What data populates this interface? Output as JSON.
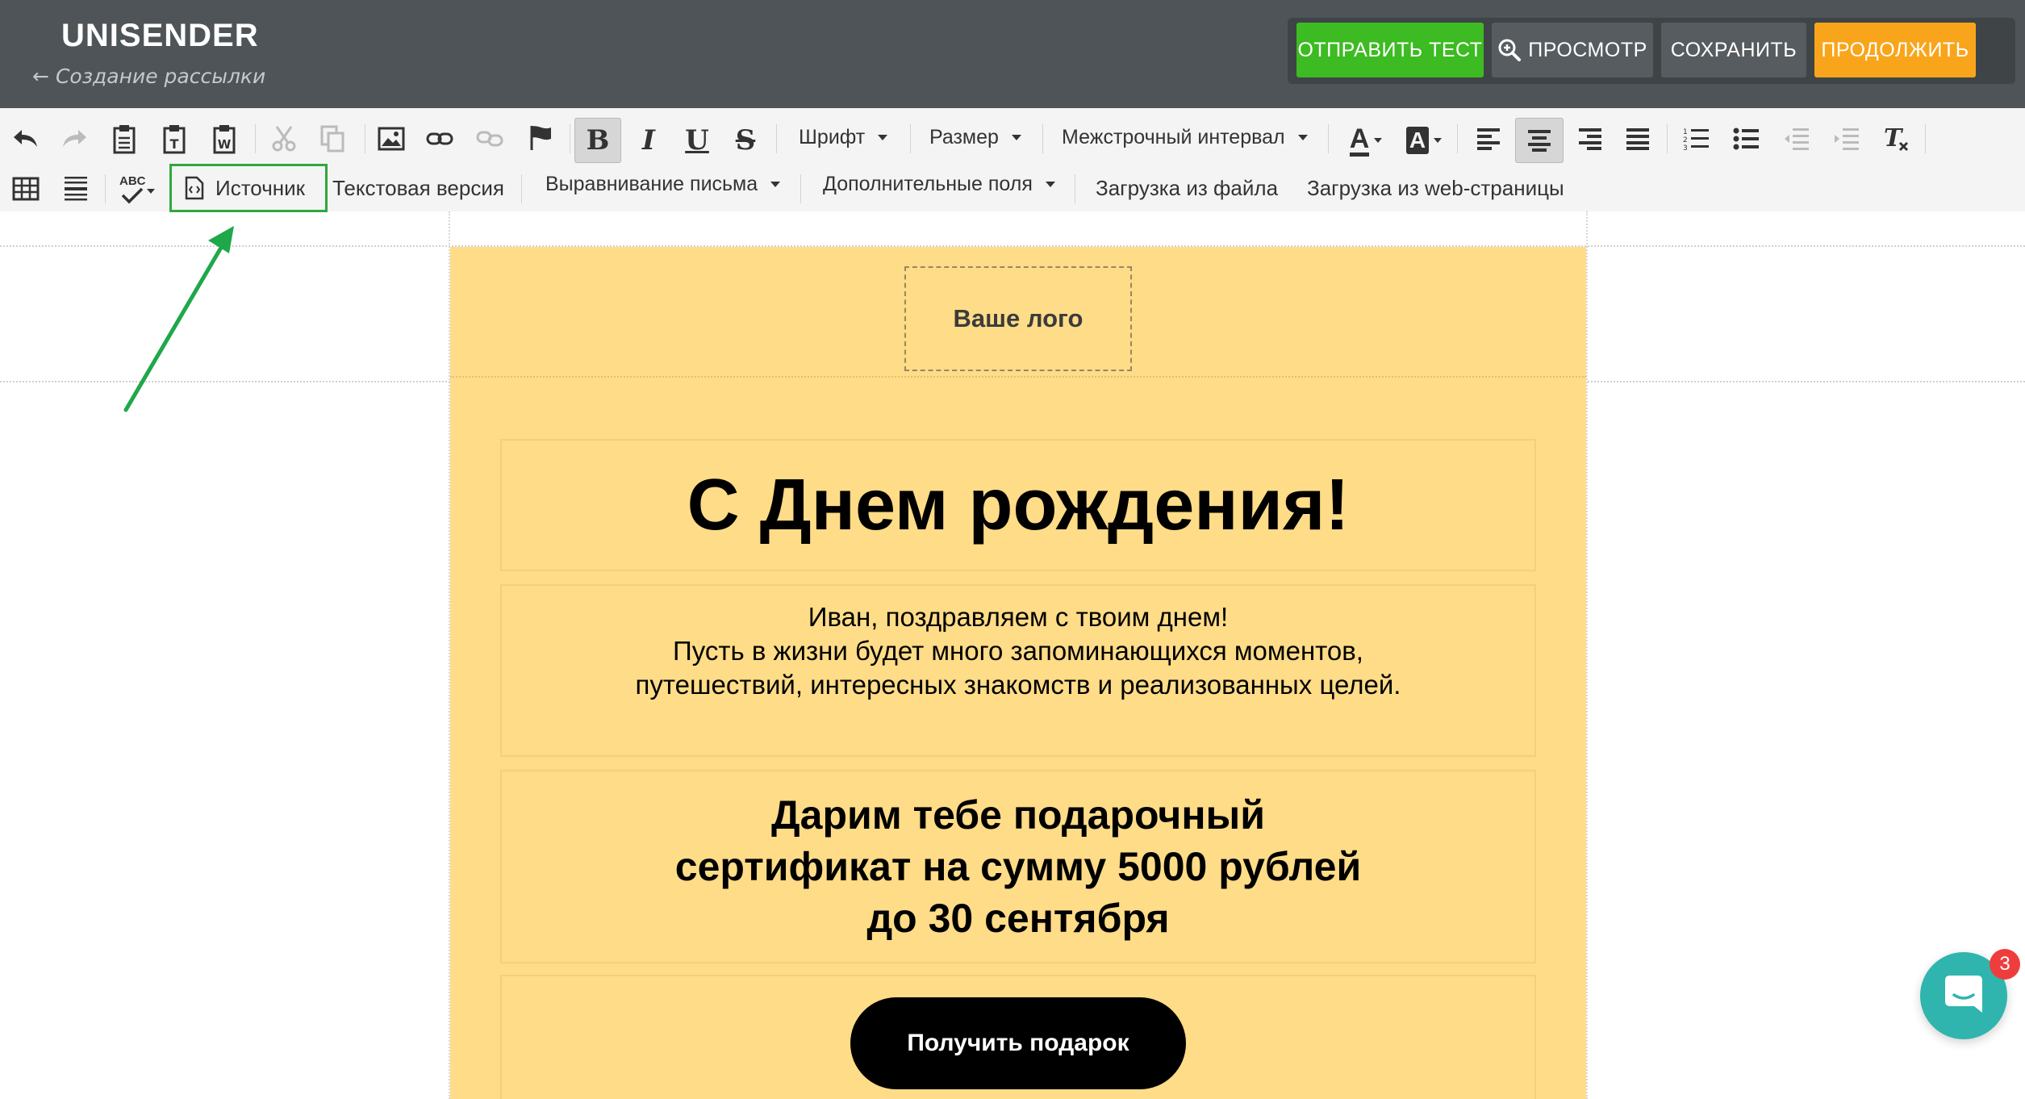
{
  "header": {
    "logo": "UNISENDER",
    "back_arrow": "←",
    "subtitle": "Создание рассылки",
    "buttons": {
      "send_test": "ОТПРАВИТЬ ТЕСТ",
      "preview": "ПРОСМОТР",
      "save": "СОХРАНИТЬ",
      "continue": "ПРОДОЛЖИТЬ"
    }
  },
  "toolbar": {
    "font": "Шрифт",
    "size": "Размер",
    "line_height": "Межстрочный интервал",
    "bold": "B",
    "italic": "I",
    "underline": "U",
    "strike": "S",
    "text_color": "A",
    "bg_color": "A",
    "spell": "ABC",
    "source": "Источник",
    "text_version": "Текстовая версия",
    "align_letter": "Выравнивание письма",
    "extra_fields": "Дополнительные поля",
    "load_file": "Загрузка из файла",
    "load_web": "Загрузка из web-страницы"
  },
  "email": {
    "logo_placeholder": "Ваше лого",
    "title": "С Днем рождения!",
    "text": "Иван, поздравляем с твоим днем!\nПусть в жизни будет много запоминающихся моментов,\nпутешествий, интересных знакомств и реализованных целей.",
    "offer": "Дарим тебе подарочный\nсертификат на сумму 5000 рублей\nдо 30 сентября",
    "button": "Получить подарок"
  },
  "chat": {
    "badge": "3"
  },
  "colors": {
    "header_bg": "#4f5458",
    "send_test": "#3dbb22",
    "continue": "#f9a51b",
    "email_bg": "#ffdc87",
    "highlight": "#2fa83b",
    "chat": "#2fb5ad"
  }
}
